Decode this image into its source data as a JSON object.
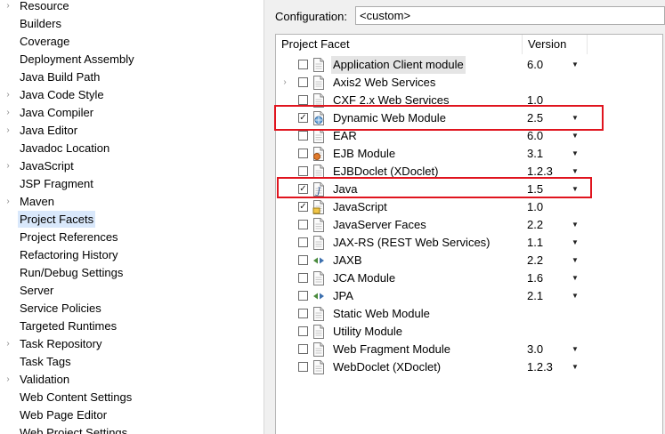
{
  "nav": {
    "items": [
      {
        "label": "Resource",
        "expandable": true
      },
      {
        "label": "Builders",
        "expandable": false
      },
      {
        "label": "Coverage",
        "expandable": false
      },
      {
        "label": "Deployment Assembly",
        "expandable": false
      },
      {
        "label": "Java Build Path",
        "expandable": false
      },
      {
        "label": "Java Code Style",
        "expandable": true
      },
      {
        "label": "Java Compiler",
        "expandable": true
      },
      {
        "label": "Java Editor",
        "expandable": true
      },
      {
        "label": "Javadoc Location",
        "expandable": false
      },
      {
        "label": "JavaScript",
        "expandable": true
      },
      {
        "label": "JSP Fragment",
        "expandable": false
      },
      {
        "label": "Maven",
        "expandable": true
      },
      {
        "label": "Project Facets",
        "expandable": false,
        "selected": true
      },
      {
        "label": "Project References",
        "expandable": false
      },
      {
        "label": "Refactoring History",
        "expandable": false
      },
      {
        "label": "Run/Debug Settings",
        "expandable": false
      },
      {
        "label": "Server",
        "expandable": false
      },
      {
        "label": "Service Policies",
        "expandable": false
      },
      {
        "label": "Targeted Runtimes",
        "expandable": false
      },
      {
        "label": "Task Repository",
        "expandable": true
      },
      {
        "label": "Task Tags",
        "expandable": false
      },
      {
        "label": "Validation",
        "expandable": true
      },
      {
        "label": "Web Content Settings",
        "expandable": false
      },
      {
        "label": "Web Page Editor",
        "expandable": false
      },
      {
        "label": "Web Project Settings",
        "expandable": false
      }
    ]
  },
  "config": {
    "label": "Configuration:",
    "value": "<custom>"
  },
  "table": {
    "headers": {
      "facet": "Project Facet",
      "version": "Version"
    },
    "rows": [
      {
        "name": "Application Client module",
        "version": "6.0",
        "checked": false,
        "icon": "page-icon",
        "highlight": true,
        "dropdown": true
      },
      {
        "name": "Axis2 Web Services",
        "version": "",
        "checked": false,
        "icon": "page-icon",
        "expandable": true,
        "dropdown": false
      },
      {
        "name": "CXF 2.x Web Services",
        "version": "1.0",
        "checked": false,
        "icon": "page-icon",
        "dropdown": false
      },
      {
        "name": "Dynamic Web Module",
        "version": "2.5",
        "checked": true,
        "icon": "globe-page-icon",
        "dropdown": true
      },
      {
        "name": "EAR",
        "version": "6.0",
        "checked": false,
        "icon": "page-icon",
        "dropdown": true
      },
      {
        "name": "EJB Module",
        "version": "3.1",
        "checked": false,
        "icon": "ejb-page-icon",
        "dropdown": true
      },
      {
        "name": "EJBDoclet (XDoclet)",
        "version": "1.2.3",
        "checked": false,
        "icon": "page-icon",
        "dropdown": true
      },
      {
        "name": "Java",
        "version": "1.5",
        "checked": true,
        "icon": "java-page-icon",
        "dropdown": true
      },
      {
        "name": "JavaScript",
        "version": "1.0",
        "checked": true,
        "icon": "javascript-page-icon",
        "dropdown": false
      },
      {
        "name": "JavaServer Faces",
        "version": "2.2",
        "checked": false,
        "icon": "page-icon",
        "dropdown": true
      },
      {
        "name": "JAX-RS (REST Web Services)",
        "version": "1.1",
        "checked": false,
        "icon": "page-icon",
        "dropdown": true
      },
      {
        "name": "JAXB",
        "version": "2.2",
        "checked": false,
        "icon": "arrows-icon",
        "dropdown": true
      },
      {
        "name": "JCA Module",
        "version": "1.6",
        "checked": false,
        "icon": "page-icon",
        "dropdown": true
      },
      {
        "name": "JPA",
        "version": "2.1",
        "checked": false,
        "icon": "arrows-icon",
        "dropdown": true
      },
      {
        "name": "Static Web Module",
        "version": "",
        "checked": false,
        "icon": "page-icon",
        "dropdown": false
      },
      {
        "name": "Utility Module",
        "version": "",
        "checked": false,
        "icon": "page-icon",
        "dropdown": false
      },
      {
        "name": "Web Fragment Module",
        "version": "3.0",
        "checked": false,
        "icon": "page-icon",
        "dropdown": true
      },
      {
        "name": "WebDoclet (XDoclet)",
        "version": "1.2.3",
        "checked": false,
        "icon": "page-icon",
        "dropdown": true
      }
    ]
  },
  "glyphs": {
    "dropdown": "▼",
    "expand": "›",
    "check": "✓"
  },
  "colors": {
    "highlight_box": "#e0141e",
    "selection": "#d9e8fb"
  }
}
